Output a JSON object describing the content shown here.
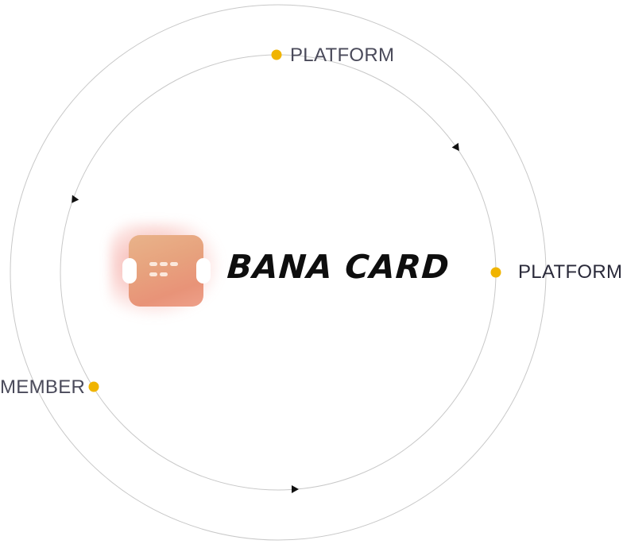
{
  "brand": {
    "name": "BANA CARD"
  },
  "nodes": {
    "top": "PLATFORM",
    "right": "PLATFORM",
    "member": "MEMBER"
  },
  "colors": {
    "node_dot": "#f0b400",
    "ring_stroke": "#c8c8c8",
    "arrow": "#111111",
    "logo_gradient": [
      "#e9b38a",
      "#e89378"
    ]
  },
  "icons": {
    "logo": "ticket-card-icon",
    "flow_arrow": "triangle-arrow-icon"
  }
}
